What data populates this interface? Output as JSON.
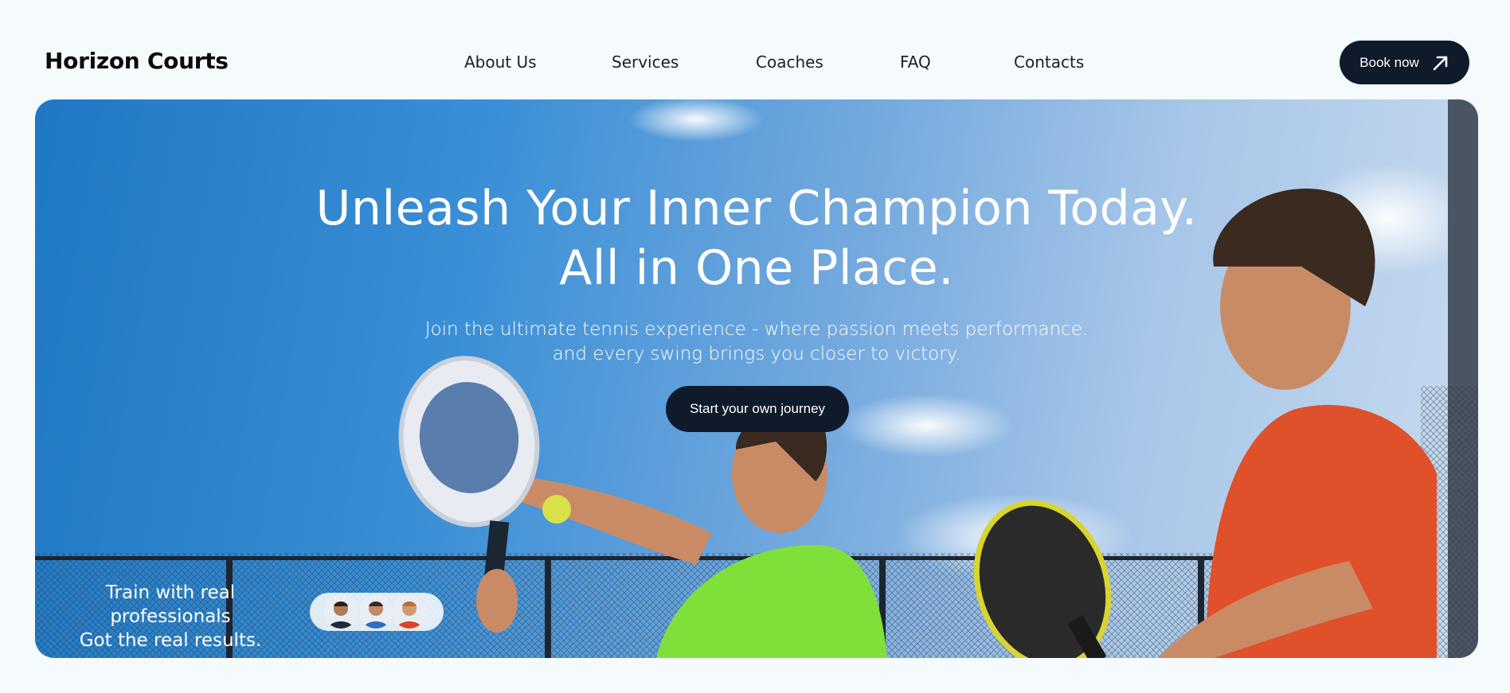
{
  "header": {
    "logo": "Horizon Courts",
    "nav": [
      {
        "label": "About Us"
      },
      {
        "label": "Services"
      },
      {
        "label": "Coaches"
      },
      {
        "label": "FAQ"
      },
      {
        "label": "Contacts"
      }
    ],
    "book_button": {
      "label": "Book now",
      "icon": "arrow-up-right-icon"
    }
  },
  "hero": {
    "title_line1": "Unleash Your Inner Champion Today.",
    "title_line2": "All in One Place.",
    "subtitle_line1": "Join the ultimate tennis experience - where passion meets performance.",
    "subtitle_line2": "and every swing brings you closer to victory.",
    "cta_label": "Start your own journey",
    "pros_line1": "Train with real professionals",
    "pros_line2": "Got the real results.",
    "avatars": [
      "coach-avatar",
      "coach-avatar",
      "coach-avatar"
    ]
  },
  "colors": {
    "background": "#f5fbfd",
    "button_dark": "#0f1a2b",
    "sky": "#3a8fd6",
    "shirt_green": "#7fe03a",
    "shirt_red": "#e0502a"
  }
}
